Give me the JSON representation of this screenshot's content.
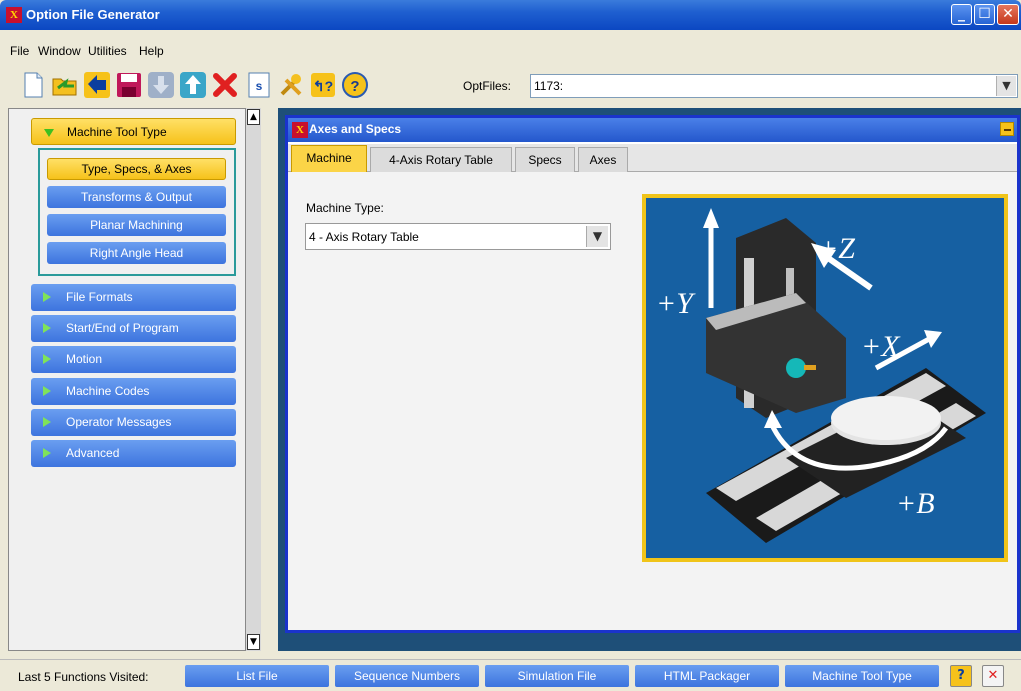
{
  "window": {
    "title": "Option File Generator",
    "app_icon": "X"
  },
  "menu": [
    "File",
    "Window",
    "Utilities",
    "Help"
  ],
  "toolbar": {
    "icons": [
      "new-file-icon",
      "open-folder-icon",
      "back-arrow-icon",
      "save-icon",
      "down-arrow-icon",
      "up-arrow-icon",
      "delete-x-icon",
      "script-icon",
      "tools-icon",
      "context-help-icon",
      "help-icon"
    ],
    "optfiles_label": "OptFiles:",
    "optfiles_value": "1173:"
  },
  "sidebar": {
    "sections": [
      {
        "label": "Machine Tool Type",
        "active": true
      },
      {
        "label": "File Formats"
      },
      {
        "label": "Start/End of Program"
      },
      {
        "label": "Motion"
      },
      {
        "label": "Machine Codes"
      },
      {
        "label": "Operator Messages"
      },
      {
        "label": "Advanced"
      }
    ],
    "subitems": [
      {
        "label": "Type, Specs, & Axes",
        "active": true
      },
      {
        "label": "Transforms & Output"
      },
      {
        "label": "Planar Machining"
      },
      {
        "label": "Right Angle Head"
      }
    ]
  },
  "panel": {
    "title": "Axes and Specs",
    "tabs": [
      {
        "label": "Machine",
        "active": true
      },
      {
        "label": "4-Axis Rotary Table"
      },
      {
        "label": "Specs"
      },
      {
        "label": "Axes"
      }
    ],
    "machine_type_label": "Machine Type:",
    "machine_type_value": "4 - Axis Rotary Table",
    "axis_labels": [
      "+Y",
      "+Z",
      "+X",
      "+B"
    ]
  },
  "statusbar": {
    "label": "Last 5 Functions Visited:",
    "items": [
      "List File",
      "Sequence Numbers",
      "Simulation File",
      "HTML Packager",
      "Machine Tool Type"
    ]
  },
  "colors": {
    "accent": "#3d74de",
    "active": "#f6c21a",
    "workspace": "#1e4f78"
  }
}
